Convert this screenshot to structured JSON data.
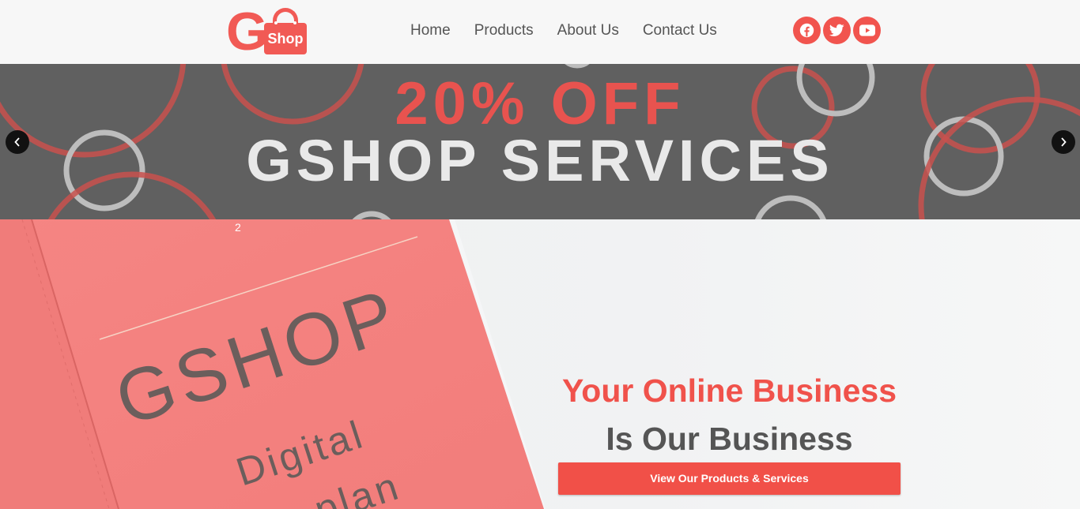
{
  "header": {
    "logo": {
      "letter": "G",
      "bag_text": "Shop"
    },
    "nav": [
      "Home",
      "Products",
      "About Us",
      "Contact Us"
    ],
    "socials": [
      {
        "icon": "facebook-icon"
      },
      {
        "icon": "twitter-icon"
      },
      {
        "icon": "youtube-icon"
      }
    ]
  },
  "banner": {
    "line1": "20% OFF",
    "line2": "GSHOP SERVICES",
    "prev_icon": "chevron-left-icon",
    "next_icon": "chevron-right-icon"
  },
  "hero": {
    "booklet": {
      "title": "GSHOP",
      "subtitle": "Digital",
      "subtitle2": "plan",
      "page_mark": "2"
    },
    "title_line1": "Your Online Business",
    "title_line2": "Is Our Business",
    "cta_label": "View Our Products & Services"
  },
  "colors": {
    "brand_red": "#f15a55",
    "banner_gray": "#606060",
    "text_gray": "#555555"
  }
}
